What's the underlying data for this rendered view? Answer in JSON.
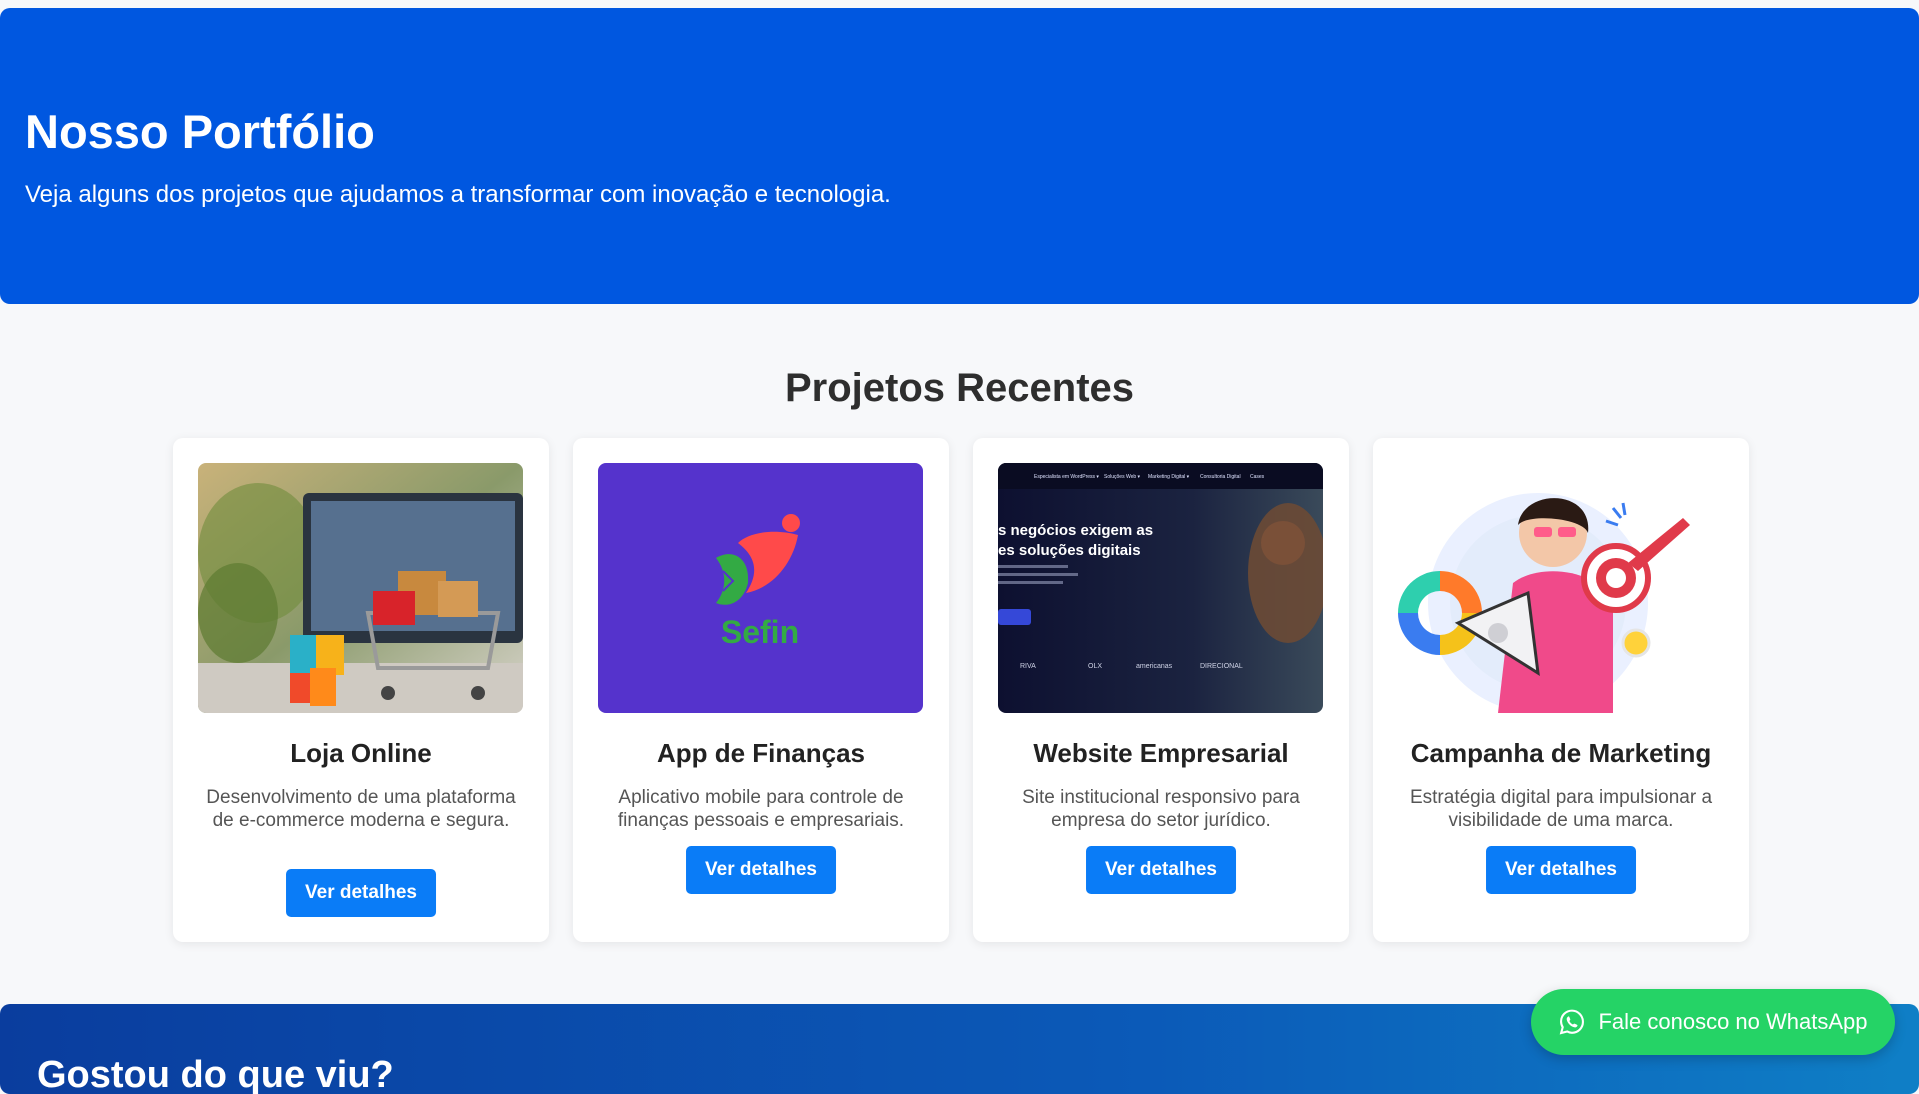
{
  "hero": {
    "title": "Nosso Portfólio",
    "subtitle": "Veja alguns dos projetos que ajudamos a transformar com inovação e tecnologia."
  },
  "projects": {
    "title": "Projetos Recentes",
    "items": [
      {
        "title": "Loja Online",
        "description": "Desenvolvimento de uma plataforma de e-commerce moderna e segura.",
        "button": "Ver detalhes"
      },
      {
        "title": "App de Finanças",
        "description": "Aplicativo mobile para controle de finanças pessoais e empresariais.",
        "button": "Ver detalhes",
        "logo_text": "Sefin"
      },
      {
        "title": "Website Empresarial",
        "description": "Site institucional responsivo para empresa do setor jurídico.",
        "button": "Ver detalhes",
        "screenshot_text": {
          "nav": [
            "Especialista em WordPress ▾",
            "Soluções Web ▾",
            "Marketing Digital ▾",
            "Consultoria Digital",
            "Cases"
          ],
          "headline_1": "s negócios exigem as",
          "headline_2": "es soluções digitais",
          "clients": [
            "RIVA",
            "OLX",
            "americanas",
            "DIRECIONAL"
          ]
        }
      },
      {
        "title": "Campanha de Marketing",
        "description": "Estratégia digital para impulsionar a visibilidade de uma marca.",
        "button": "Ver detalhes"
      }
    ]
  },
  "cta": {
    "title": "Gostou do que viu?"
  },
  "whatsapp": {
    "label": "Fale conosco no WhatsApp"
  },
  "colors": {
    "hero_bg": "#0057e0",
    "button": "#0a7cf7",
    "whatsapp": "#25d366",
    "sefin_bg": "#5533cc"
  }
}
